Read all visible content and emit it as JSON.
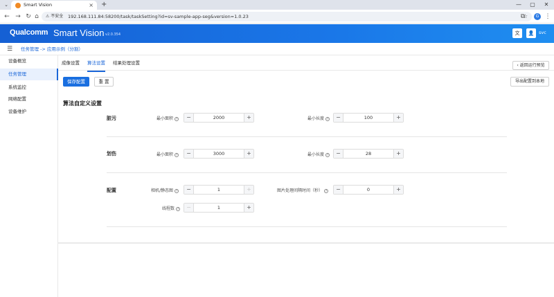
{
  "browser": {
    "tab_title": "Smart Vision",
    "tab_close": "×",
    "new_tab": "+",
    "security_label": "⚠ 不安全",
    "url": "192.168.111.84:58200/task/taskSetting?id=sv-sample-app-seg&version=1.0.23",
    "profile_initial": "G"
  },
  "header": {
    "logo": "Qualcomm",
    "product": "Smart Vision",
    "version": "v2.0.354",
    "user": "svc"
  },
  "breadcrumb": "任务管理 -> 应用示例（分割）",
  "sidebar": {
    "items": [
      {
        "label": "设备概览"
      },
      {
        "label": "任务管理"
      },
      {
        "label": "系统监控"
      },
      {
        "label": "网络配置"
      },
      {
        "label": "设备维护"
      }
    ]
  },
  "tabs": [
    {
      "label": "成像设置"
    },
    {
      "label": "算法设置"
    },
    {
      "label": "结果处理设置"
    }
  ],
  "toolbar": {
    "back_label": "返回运行预览",
    "save_label": "保存配置",
    "reset_label": "重 置",
    "export_label": "导出配置到本地"
  },
  "section_title": "算法自定义设置",
  "groups": {
    "dirty": {
      "label": "脏污",
      "min_area_label": "最小面积",
      "min_area_value": "2000",
      "min_length_label": "最小长度",
      "min_length_value": "100"
    },
    "scratch": {
      "label": "划伤",
      "min_area_label": "最小面积",
      "min_area_value": "3000",
      "min_length_label": "最小长度",
      "min_length_value": "28"
    },
    "config": {
      "label": "配置",
      "camera_label": "相机/静态图",
      "camera_value": "1",
      "interval_label": "图片处理间隔时间（秒）",
      "interval_value": "0",
      "threads_label": "线程数",
      "threads_value": "1"
    }
  },
  "icons": {
    "minus": "−",
    "plus": "+",
    "help": "?",
    "menu": "☰",
    "back_chevron": "‹"
  },
  "colors": {
    "primary": "#1a6fe0",
    "header_start": "#1560d4",
    "header_end": "#1f8ef0"
  }
}
